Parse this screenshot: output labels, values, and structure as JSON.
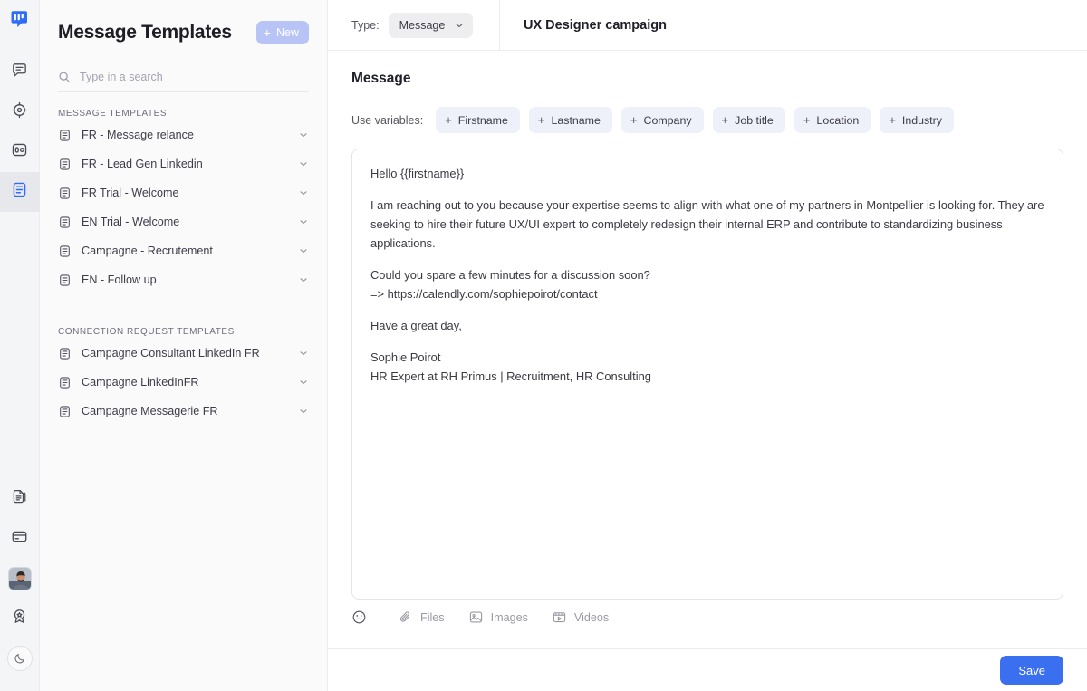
{
  "rail": {
    "logo": "chat-bars-logo",
    "top_items": [
      {
        "icon": "message-square-icon",
        "active": false
      },
      {
        "icon": "target-crosshair-icon",
        "active": false
      },
      {
        "icon": "inbox-counter-icon",
        "active": false
      },
      {
        "icon": "document-lines-icon",
        "active": true
      }
    ],
    "bottom_items": [
      {
        "icon": "stacked-files-icon"
      },
      {
        "icon": "credit-card-icon"
      },
      {
        "icon": "user-avatar-photo"
      },
      {
        "icon": "award-badge-icon"
      },
      {
        "icon": "moon-dark-mode-icon"
      }
    ]
  },
  "panel": {
    "title": "Message Templates",
    "new_label": "New",
    "new_icon": "plus-icon",
    "new_color": "#b8c4f5",
    "search": {
      "icon": "search-icon",
      "placeholder": "Type in a search",
      "value": ""
    },
    "groups": [
      {
        "label": "MESSAGE TEMPLATES",
        "items": [
          {
            "name": "FR - Message relance"
          },
          {
            "name": "FR - Lead Gen Linkedin"
          },
          {
            "name": "FR Trial - Welcome"
          },
          {
            "name": "EN Trial - Welcome"
          },
          {
            "name": "Campagne - Recrutement"
          },
          {
            "name": "EN - Follow up"
          }
        ]
      },
      {
        "label": "CONNECTION REQUEST TEMPLATES",
        "items": [
          {
            "name": "Campagne Consultant LinkedIn FR"
          },
          {
            "name": "Campagne LinkedInFR"
          },
          {
            "name": "Campagne Messagerie FR"
          }
        ]
      }
    ]
  },
  "topbar": {
    "type_label": "Type:",
    "type_value": "Message",
    "type_chevron": "chevron-down-icon",
    "campaign_title": "UX Designer campaign"
  },
  "editor": {
    "section_title": "Message",
    "variables_label": "Use variables:",
    "variables": [
      "Firstname",
      "Lastname",
      "Company",
      "Job title",
      "Location",
      "Industry"
    ],
    "body": {
      "greeting": "Hello {{firstname}}",
      "para1": "I am reaching out to you because your expertise seems to align with what one of my partners in Montpellier is looking for. They are seeking to hire their future UX/UI expert to completely redesign their internal ERP and contribute to standardizing business applications.",
      "para2_line1": "Could you spare a few minutes for a discussion soon?",
      "para2_line2": "=> https://calendly.com/sophiepoirot/contact",
      "closing": "Have a great day,",
      "sign_name": "Sophie Poirot",
      "sign_role": "HR Expert at RH Primus | Recruitment, HR Consulting"
    },
    "tools": [
      {
        "label": "",
        "icon": "emoji-smiley-icon"
      },
      {
        "label": "Files",
        "icon": "paperclip-icon"
      },
      {
        "label": "Images",
        "icon": "image-icon"
      },
      {
        "label": "Videos",
        "icon": "video-icon"
      }
    ]
  },
  "footer": {
    "save_label": "Save",
    "save_color": "#3a6ff0"
  }
}
